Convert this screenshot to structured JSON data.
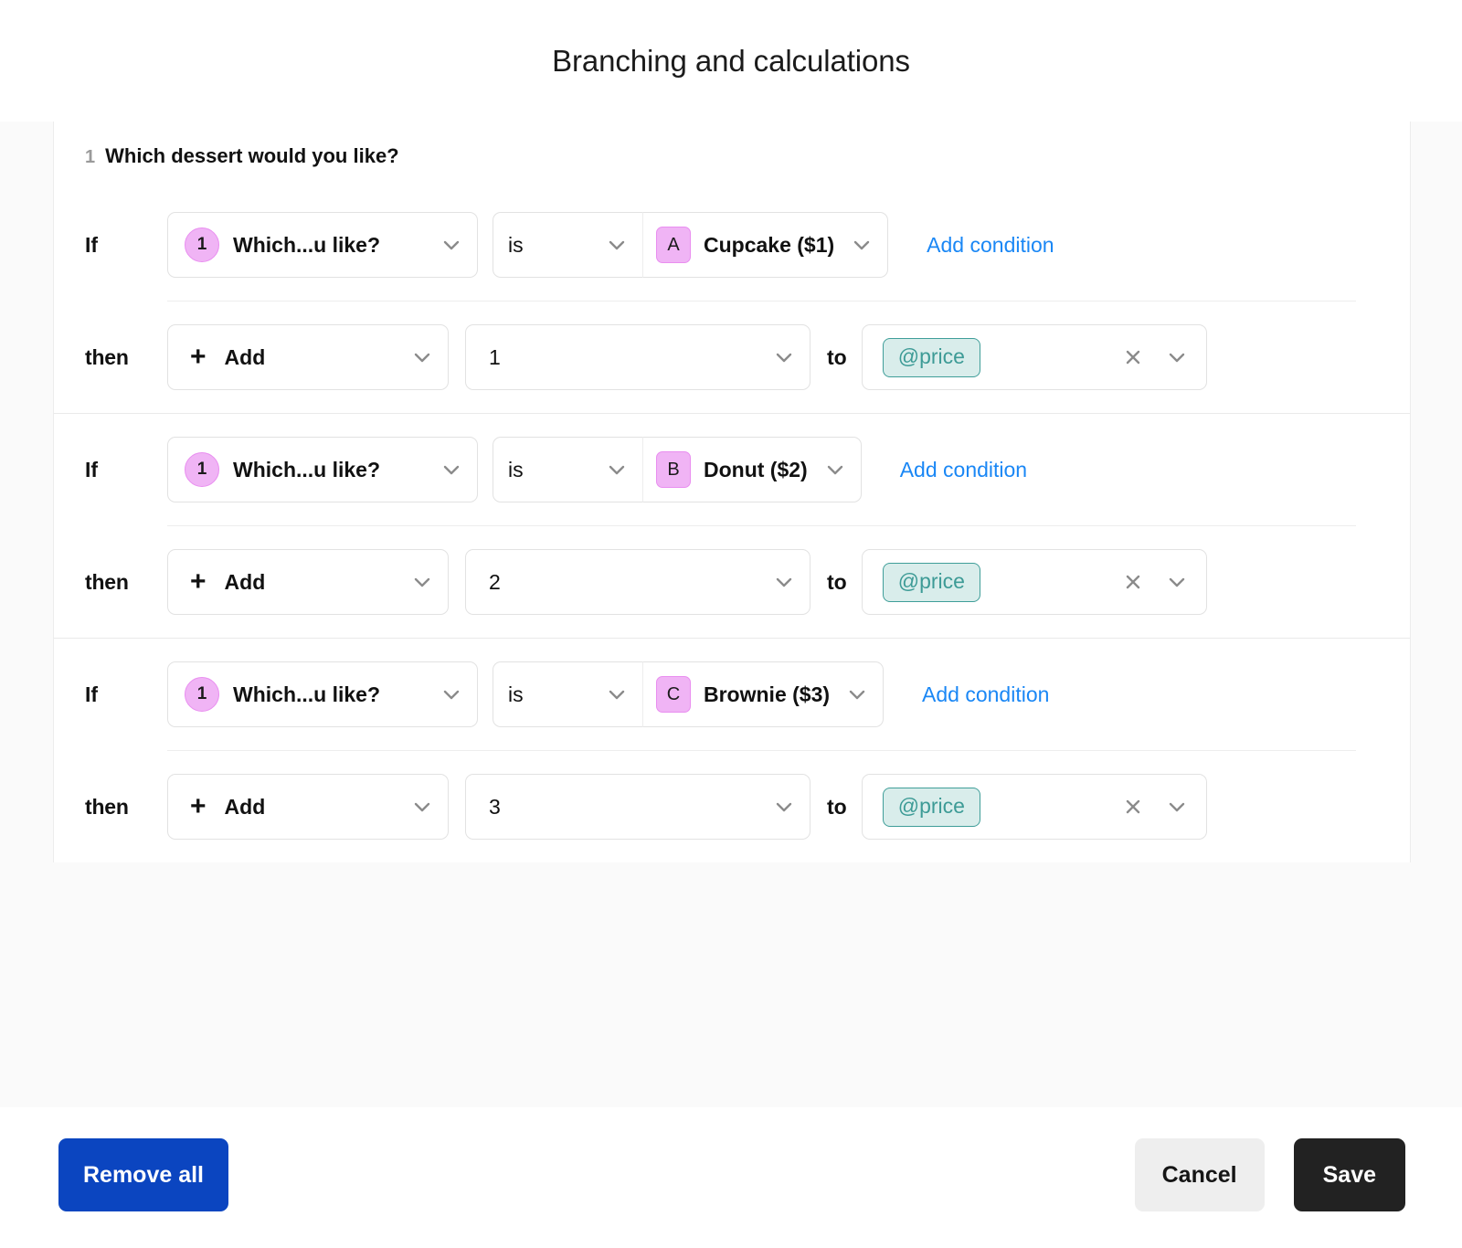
{
  "header": {
    "title": "Branching and calculations"
  },
  "question": {
    "number": "1",
    "text": "Which dessert would you like?"
  },
  "labels": {
    "if": "If",
    "then": "then",
    "to": "to",
    "add_condition": "Add condition",
    "plus_icon": "+"
  },
  "rules": [
    {
      "condition": {
        "question_badge": "1",
        "question_label": "Which...u like?",
        "operator": "is",
        "choice_badge": "A",
        "choice_label": "Cupcake ($1)",
        "add_condition": "Add condition"
      },
      "action": {
        "operation": "Add",
        "value": "1",
        "to": "to",
        "target_variable": "@price"
      }
    },
    {
      "condition": {
        "question_badge": "1",
        "question_label": "Which...u like?",
        "operator": "is",
        "choice_badge": "B",
        "choice_label": "Donut ($2)",
        "add_condition": "Add condition"
      },
      "action": {
        "operation": "Add",
        "value": "2",
        "to": "to",
        "target_variable": "@price"
      }
    },
    {
      "condition": {
        "question_badge": "1",
        "question_label": "Which...u like?",
        "operator": "is",
        "choice_badge": "C",
        "choice_label": "Brownie ($3)",
        "add_condition": "Add condition"
      },
      "action": {
        "operation": "Add",
        "value": "3",
        "to": "to",
        "target_variable": "@price"
      }
    }
  ],
  "footer": {
    "remove_all": "Remove all",
    "cancel": "Cancel",
    "save": "Save"
  },
  "colors": {
    "accent_link": "#1a87f5",
    "badge_fill": "#f0b4f5",
    "badge_border": "#e98ef0",
    "variable_fill": "#d9edeb",
    "variable_border": "#3f9e99",
    "variable_text": "#3d9b96",
    "remove_all_bg": "#0b45c0",
    "save_bg": "#222222",
    "cancel_bg": "#eeeeee"
  },
  "icons": {
    "chevron_down": "chevron-down-icon",
    "clear": "close-icon",
    "plus": "plus-icon"
  }
}
